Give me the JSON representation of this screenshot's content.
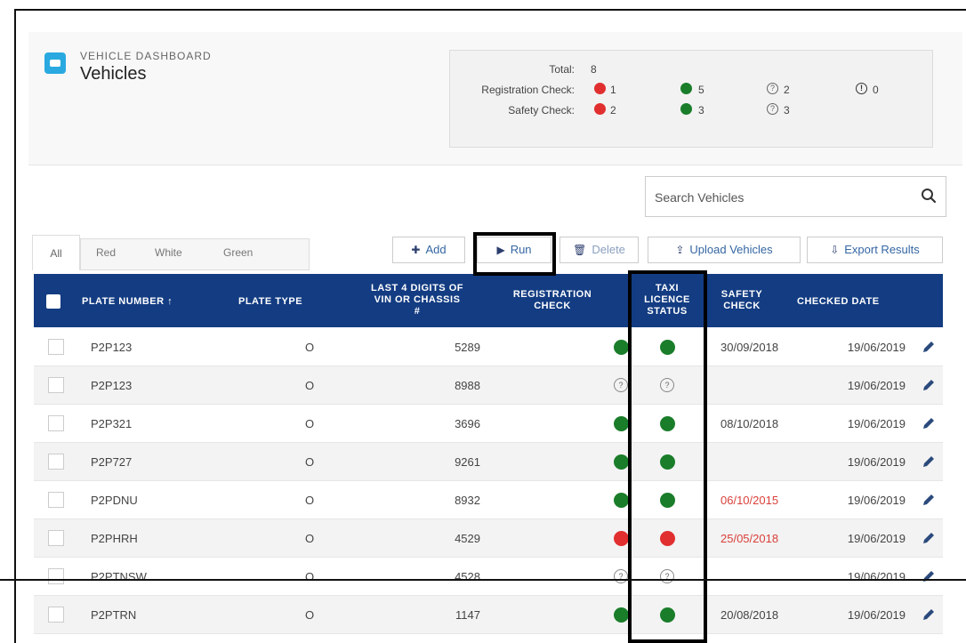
{
  "header": {
    "kicker": "VEHICLE DASHBOARD",
    "title": "Vehicles"
  },
  "summary": {
    "total_label": "Total:",
    "total_value": "8",
    "registration_label": "Registration Check:",
    "registration": {
      "fail": "1",
      "pass": "5",
      "unknown": "2",
      "info": "0"
    },
    "safety_label": "Safety Check:",
    "safety": {
      "fail": "2",
      "pass": "3",
      "unknown": "3"
    }
  },
  "search": {
    "placeholder": "Search Vehicles"
  },
  "tabs": [
    {
      "label": "All",
      "active": true
    },
    {
      "label": "Red"
    },
    {
      "label": "White"
    },
    {
      "label": "Green"
    }
  ],
  "toolbar": {
    "add": "Add",
    "run": "Run",
    "delete": "Delete",
    "upload": "Upload Vehicles",
    "export": "Export Results"
  },
  "columns": {
    "plate": "PLATE NUMBER ↑",
    "type": "PLATE TYPE",
    "vin_1": "LAST 4 DIGITS OF",
    "vin_2": "VIN OR CHASSIS",
    "vin_3": "#",
    "reg_1": "REGISTRATION",
    "reg_2": "CHECK",
    "taxi_1": "TAXI",
    "taxi_2": "LICENCE",
    "taxi_3": "STATUS",
    "safety_1": "SAFETY",
    "safety_2": "CHECK",
    "checked": "CHECKED DATE"
  },
  "rows": [
    {
      "plate": "P2P123",
      "type": "O",
      "vin": "5289",
      "reg": "green",
      "taxi": "green",
      "safety": "30/09/2018",
      "safety_alert": false,
      "checked": "19/06/2019"
    },
    {
      "plate": "P2P123",
      "type": "O",
      "vin": "8988",
      "reg": "unknown",
      "taxi": "unknown",
      "safety": "",
      "safety_alert": false,
      "checked": "19/06/2019"
    },
    {
      "plate": "P2P321",
      "type": "O",
      "vin": "3696",
      "reg": "green",
      "taxi": "green",
      "safety": "08/10/2018",
      "safety_alert": false,
      "checked": "19/06/2019"
    },
    {
      "plate": "P2P727",
      "type": "O",
      "vin": "9261",
      "reg": "green",
      "taxi": "green",
      "safety": "",
      "safety_alert": false,
      "checked": "19/06/2019"
    },
    {
      "plate": "P2PDNU",
      "type": "O",
      "vin": "8932",
      "reg": "green",
      "taxi": "green",
      "safety": "06/10/2015",
      "safety_alert": true,
      "checked": "19/06/2019"
    },
    {
      "plate": "P2PHRH",
      "type": "O",
      "vin": "4529",
      "reg": "red",
      "taxi": "red",
      "safety": "25/05/2018",
      "safety_alert": true,
      "checked": "19/06/2019"
    },
    {
      "plate": "P2PTNSW",
      "type": "O",
      "vin": "4528",
      "reg": "unknown",
      "taxi": "unknown",
      "safety": "",
      "safety_alert": false,
      "checked": "19/06/2019"
    },
    {
      "plate": "P2PTRN",
      "type": "O",
      "vin": "1147",
      "reg": "green",
      "taxi": "green",
      "safety": "20/08/2018",
      "safety_alert": false,
      "checked": "19/06/2019"
    }
  ],
  "colors": {
    "header_bg": "#133c82",
    "pass": "#1a7d2a",
    "fail": "#e12f2f",
    "alert_text": "#d9403a",
    "link": "#3466a3"
  }
}
